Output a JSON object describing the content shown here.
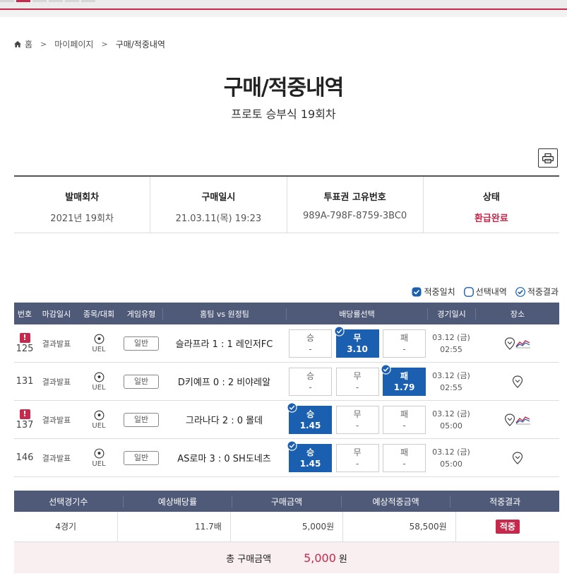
{
  "breadcrumb": {
    "home": "홈",
    "mypage": "마이페이지",
    "current": "구매/적중내역"
  },
  "page": {
    "title": "구매/적중내역",
    "subtitle": "프로토 승부식 19회차"
  },
  "info": {
    "round_label": "발매회차",
    "round_value": "2021년 19회차",
    "date_label": "구매일시",
    "date_value": "21.03.11(목) 19:23",
    "ticket_label": "투표권 고유번호",
    "ticket_value": "989A-798F-8759-3BC0",
    "status_label": "상태",
    "status_value": "환급완료"
  },
  "legend": {
    "match": "적중일치",
    "selection": "선택내역",
    "result": "적중결과"
  },
  "table": {
    "headers": {
      "no": "번호",
      "deadline": "마감일시",
      "sport": "종목/대회",
      "gametype": "게임유형",
      "match": "홈팀 vs 원정팀",
      "odds": "배당률선택",
      "date": "경기일시",
      "place": "장소"
    },
    "rows": [
      {
        "no": "125",
        "deadline": "결과발표",
        "league": "UEL",
        "gametype": "일반",
        "match": "슬라프라 1 : 1 레인저FC",
        "odds": [
          {
            "label": "승",
            "value": "-"
          },
          {
            "label": "무",
            "value": "3.10"
          },
          {
            "label": "패",
            "value": "-"
          }
        ],
        "date1": "03.12 (금)",
        "date2": "02:55"
      },
      {
        "no": "131",
        "deadline": "결과발표",
        "league": "UEL",
        "gametype": "일반",
        "match": "D키예프 0 : 2 비야레알",
        "odds": [
          {
            "label": "승",
            "value": "-"
          },
          {
            "label": "무",
            "value": "-"
          },
          {
            "label": "패",
            "value": "1.79"
          }
        ],
        "date1": "03.12 (금)",
        "date2": "02:55"
      },
      {
        "no": "137",
        "deadline": "결과발표",
        "league": "UEL",
        "gametype": "일반",
        "match": "그라나다 2 : 0 몰데",
        "odds": [
          {
            "label": "승",
            "value": "1.45"
          },
          {
            "label": "무",
            "value": "-"
          },
          {
            "label": "패",
            "value": "-"
          }
        ],
        "date1": "03.12 (금)",
        "date2": "05:00"
      },
      {
        "no": "146",
        "deadline": "결과발표",
        "league": "UEL",
        "gametype": "일반",
        "match": "AS로마 3 : 0 SH도네츠",
        "odds": [
          {
            "label": "승",
            "value": "1.45"
          },
          {
            "label": "무",
            "value": "-"
          },
          {
            "label": "패",
            "value": "-"
          }
        ],
        "date1": "03.12 (금)",
        "date2": "05:00"
      }
    ]
  },
  "summary": {
    "headers": {
      "count": "선택경기수",
      "odds": "예상배당률",
      "amount": "구매금액",
      "expected": "예상적중금액",
      "result": "적중결과"
    },
    "values": {
      "count": "4경기",
      "odds": "11.7배",
      "amount": "5,000원",
      "expected": "58,500원",
      "result": "적중"
    },
    "total_label": "총 구매금액",
    "total_value": "5,000",
    "total_unit": "원"
  },
  "colors": {
    "accent": "#c6294b",
    "header": "#4f5a78",
    "selected": "#1a5fb0"
  },
  "icons": {
    "home": "home-icon",
    "print": "printer-icon",
    "ball": "soccer-ball-icon",
    "place": "map-pin-icon",
    "trend": "trend-chart-icon",
    "check": "check-circle-icon",
    "alert": "exclamation-icon"
  }
}
